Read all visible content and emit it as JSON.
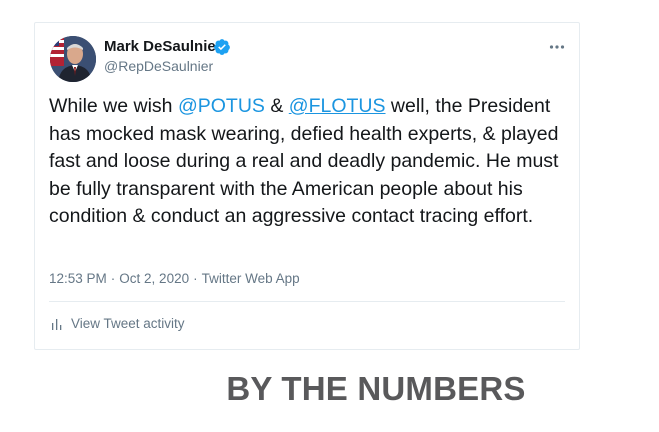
{
  "tweet": {
    "author_name": "Mark DeSaulnier",
    "author_handle": "@RepDeSaulnier",
    "text_parts": {
      "p1": "While we wish ",
      "mention1": "@POTUS",
      "p2": " & ",
      "mention2": "@FLOTUS",
      "p3": " well, the President has mocked mask wearing, defied health experts, & played fast and loose during a real and deadly pandemic. He must be fully transparent with the American people about his condition & conduct an aggressive contact tracing effort."
    },
    "time": "12:53 PM",
    "separator": "·",
    "date": "Oct 2, 2020",
    "source": "Twitter Web App",
    "activity_label": "View Tweet activity",
    "icons": {
      "verified": "verified-badge-icon",
      "more": "more-options-icon",
      "activity": "bar-chart-icon"
    }
  },
  "section": {
    "heading": "BY THE NUMBERS"
  },
  "colors": {
    "link": "#1b95e0",
    "secondary_text": "#657786",
    "primary_text": "#14171a",
    "verified": "#1da1f2",
    "heading": "#59595b"
  }
}
